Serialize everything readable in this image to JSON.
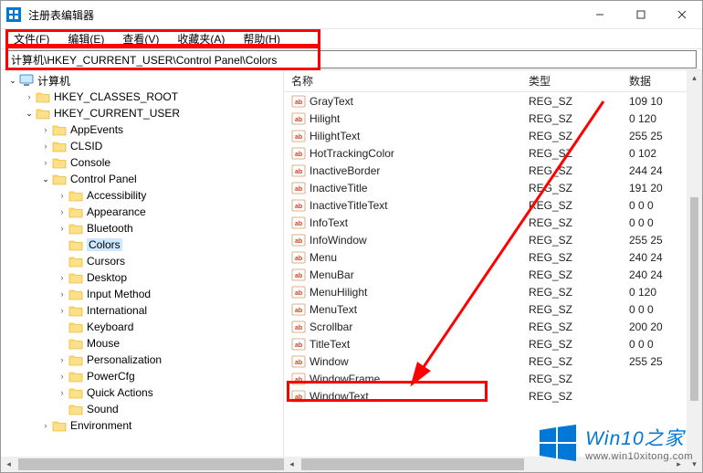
{
  "window": {
    "title": "注册表编辑器"
  },
  "menubar": [
    "文件(F)",
    "编辑(E)",
    "查看(V)",
    "收藏夹(A)",
    "帮助(H)"
  ],
  "address": "计算机\\HKEY_CURRENT_USER\\Control Panel\\Colors",
  "tree": [
    {
      "depth": 0,
      "expander": "open",
      "icon": "pc",
      "label": "计算机",
      "selected": false
    },
    {
      "depth": 1,
      "expander": "closed",
      "icon": "folder",
      "label": "HKEY_CLASSES_ROOT"
    },
    {
      "depth": 1,
      "expander": "open",
      "icon": "folder",
      "label": "HKEY_CURRENT_USER"
    },
    {
      "depth": 2,
      "expander": "closed",
      "icon": "folder",
      "label": "AppEvents"
    },
    {
      "depth": 2,
      "expander": "closed",
      "icon": "folder",
      "label": "CLSID"
    },
    {
      "depth": 2,
      "expander": "closed",
      "icon": "folder",
      "label": "Console"
    },
    {
      "depth": 2,
      "expander": "open",
      "icon": "folder",
      "label": "Control Panel"
    },
    {
      "depth": 3,
      "expander": "closed",
      "icon": "folder",
      "label": "Accessibility"
    },
    {
      "depth": 3,
      "expander": "closed",
      "icon": "folder",
      "label": "Appearance"
    },
    {
      "depth": 3,
      "expander": "closed",
      "icon": "folder",
      "label": "Bluetooth"
    },
    {
      "depth": 3,
      "expander": "none",
      "icon": "folder",
      "label": "Colors",
      "selected": true
    },
    {
      "depth": 3,
      "expander": "none",
      "icon": "folder",
      "label": "Cursors"
    },
    {
      "depth": 3,
      "expander": "closed",
      "icon": "folder",
      "label": "Desktop"
    },
    {
      "depth": 3,
      "expander": "closed",
      "icon": "folder",
      "label": "Input Method"
    },
    {
      "depth": 3,
      "expander": "closed",
      "icon": "folder",
      "label": "International"
    },
    {
      "depth": 3,
      "expander": "none",
      "icon": "folder",
      "label": "Keyboard"
    },
    {
      "depth": 3,
      "expander": "none",
      "icon": "folder",
      "label": "Mouse"
    },
    {
      "depth": 3,
      "expander": "closed",
      "icon": "folder",
      "label": "Personalization"
    },
    {
      "depth": 3,
      "expander": "closed",
      "icon": "folder",
      "label": "PowerCfg"
    },
    {
      "depth": 3,
      "expander": "closed",
      "icon": "folder",
      "label": "Quick Actions"
    },
    {
      "depth": 3,
      "expander": "none",
      "icon": "folder",
      "label": "Sound"
    },
    {
      "depth": 2,
      "expander": "closed",
      "icon": "folder",
      "label": "Environment"
    }
  ],
  "columns": {
    "name": "名称",
    "type": "类型",
    "data": "数据"
  },
  "values": [
    {
      "name": "GrayText",
      "type": "REG_SZ",
      "data": "109 10"
    },
    {
      "name": "Hilight",
      "type": "REG_SZ",
      "data": "0 120"
    },
    {
      "name": "HilightText",
      "type": "REG_SZ",
      "data": "255 25"
    },
    {
      "name": "HotTrackingColor",
      "type": "REG_SZ",
      "data": "0 102"
    },
    {
      "name": "InactiveBorder",
      "type": "REG_SZ",
      "data": "244 24"
    },
    {
      "name": "InactiveTitle",
      "type": "REG_SZ",
      "data": "191 20"
    },
    {
      "name": "InactiveTitleText",
      "type": "REG_SZ",
      "data": "0 0 0"
    },
    {
      "name": "InfoText",
      "type": "REG_SZ",
      "data": "0 0 0"
    },
    {
      "name": "InfoWindow",
      "type": "REG_SZ",
      "data": "255 25"
    },
    {
      "name": "Menu",
      "type": "REG_SZ",
      "data": "240 24"
    },
    {
      "name": "MenuBar",
      "type": "REG_SZ",
      "data": "240 24"
    },
    {
      "name": "MenuHilight",
      "type": "REG_SZ",
      "data": "0 120"
    },
    {
      "name": "MenuText",
      "type": "REG_SZ",
      "data": "0 0 0"
    },
    {
      "name": "Scrollbar",
      "type": "REG_SZ",
      "data": "200 20"
    },
    {
      "name": "TitleText",
      "type": "REG_SZ",
      "data": "0 0 0"
    },
    {
      "name": "Window",
      "type": "REG_SZ",
      "data": "255 25"
    },
    {
      "name": "WindowFrame",
      "type": "REG_SZ",
      "data": ""
    },
    {
      "name": "WindowText",
      "type": "REG_SZ",
      "data": ""
    }
  ],
  "watermark": {
    "title": "Win10之家",
    "url": "www.win10xitong.com"
  }
}
